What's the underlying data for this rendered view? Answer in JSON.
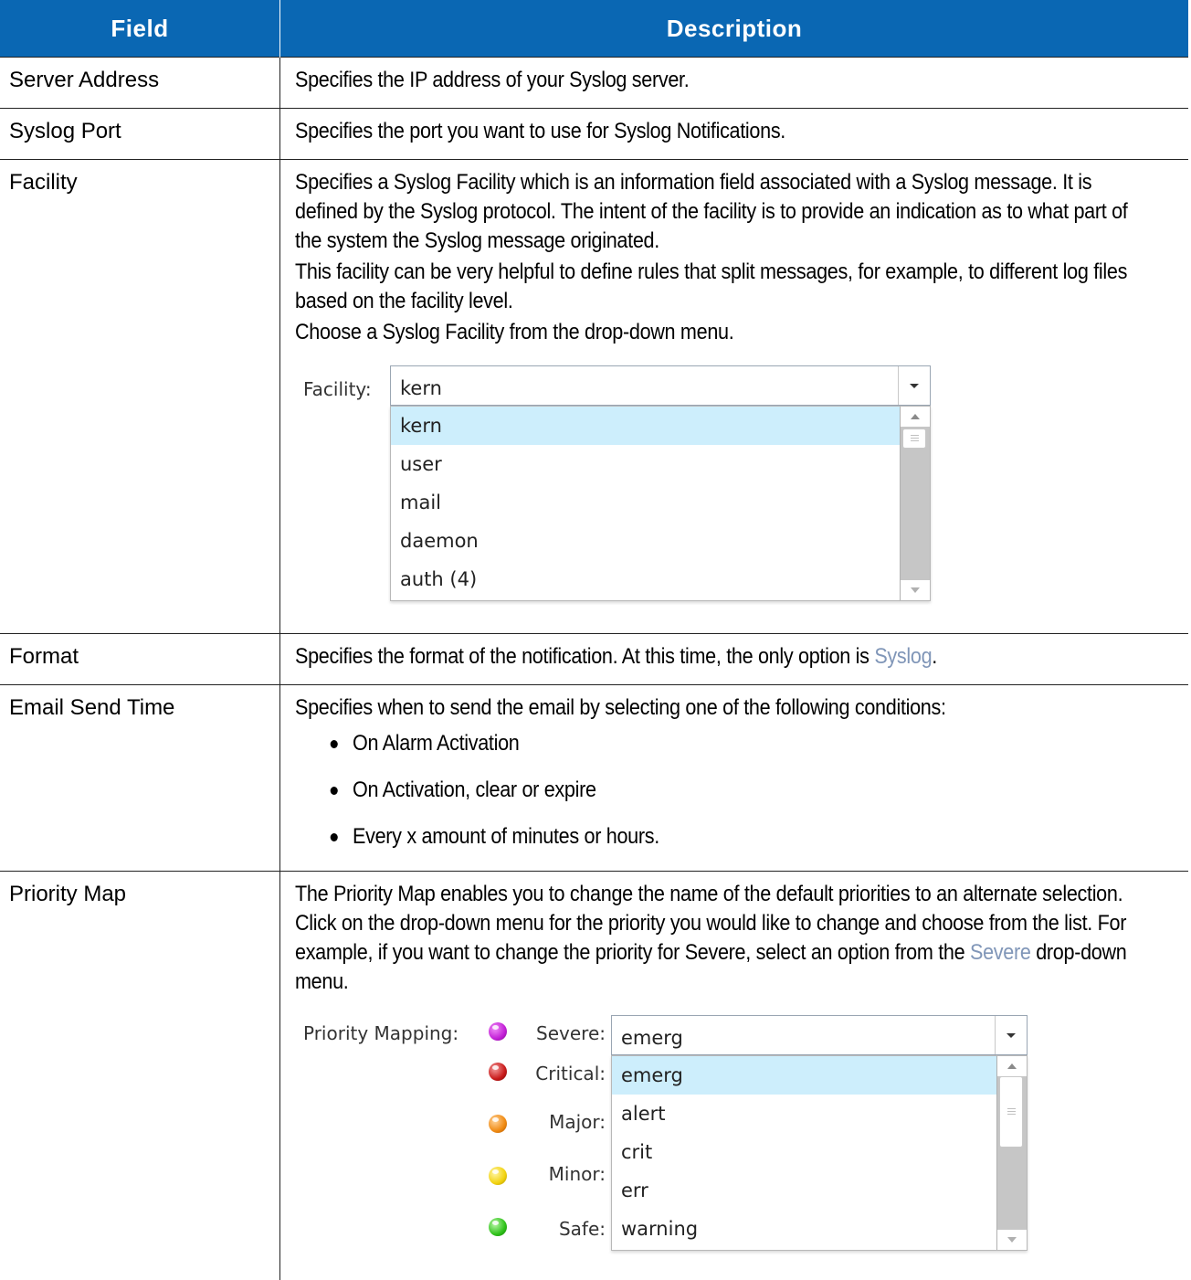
{
  "header": {
    "field_label": "Field",
    "description_label": "Description"
  },
  "rows": {
    "server_address": {
      "field": "Server Address",
      "desc": "Specifies the IP address of your Syslog server."
    },
    "syslog_port": {
      "field": "Syslog Port",
      "desc": "Specifies the port you want to use for Syslog Notifications."
    },
    "facility": {
      "field": "Facility",
      "p1": "Specifies a Syslog Facility which is an information field associated with a Syslog message. It is defined by the Syslog protocol. The intent of the facility is to provide an indication as to what part of the system the Syslog message originated.",
      "p2": "This facility can be very helpful to define rules that split messages, for example, to different log files based on the facility level.",
      "p3": "Choose a Syslog Facility from the drop-down menu.",
      "ui": {
        "label": "Facility:",
        "selected": "kern",
        "options": [
          "kern",
          "user",
          "mail",
          "daemon",
          "auth (4)"
        ]
      }
    },
    "format": {
      "field": "Format",
      "desc_before": "Specifies the format of the notification. At this time, the only option is ",
      "desc_link": "Syslog",
      "desc_after": "."
    },
    "email_send_time": {
      "field": "Email Send Time",
      "desc": "Specifies when to send the email by selecting one of the following conditions:",
      "bullets": [
        "On Alarm Activation",
        "On Activation, clear or expire",
        "Every x amount of minutes or hours."
      ]
    },
    "priority_map": {
      "field": "Priority Map",
      "desc_before": "The Priority Map enables you to change the name of the default priorities to an alternate selection. Click on the drop-down menu for the priority you would like to change and choose from the list. For example, if you want to change the priority for Severe, select an option from the ",
      "desc_link": "Severe",
      "desc_after": " drop-down menu.",
      "ui": {
        "mapping_label": "Priority Mapping:",
        "selected": "emerg",
        "levels": [
          {
            "label": "Severe:",
            "color": "#c21fd6"
          },
          {
            "label": "Critical:",
            "color": "#c81a1a"
          },
          {
            "label": "Major:",
            "color": "#f08a12"
          },
          {
            "label": "Minor:",
            "color": "#f2d20f"
          },
          {
            "label": "Safe:",
            "color": "#2fc21a"
          }
        ],
        "options": [
          "emerg",
          "alert",
          "crit",
          "err",
          "warning"
        ]
      }
    }
  }
}
